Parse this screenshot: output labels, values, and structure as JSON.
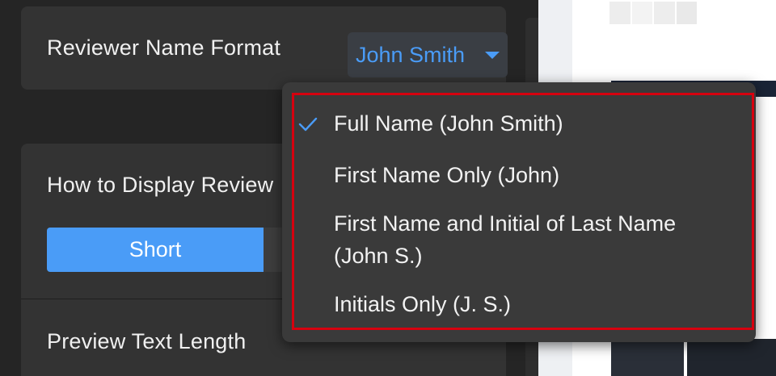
{
  "reviewer_name_format": {
    "label": "Reviewer Name Format",
    "selected_value": "John Smith",
    "caret_icon": "caret-down-icon",
    "accent_color": "#4a9cf7"
  },
  "display_reviews": {
    "label": "How to Display Review",
    "segments": {
      "active_label": "Short"
    }
  },
  "preview_text_length": {
    "label": "Preview Text Length"
  },
  "dropdown": {
    "options": [
      {
        "label": "Full Name (John Smith)",
        "selected": true
      },
      {
        "label": "First Name Only (John)",
        "selected": false
      },
      {
        "label": "First Name and Initial of Last Name (John S.)",
        "selected": false
      },
      {
        "label": "Initials Only (J. S.)",
        "selected": false
      }
    ],
    "check_icon": "check-icon",
    "highlight_color": "#d6000f"
  }
}
